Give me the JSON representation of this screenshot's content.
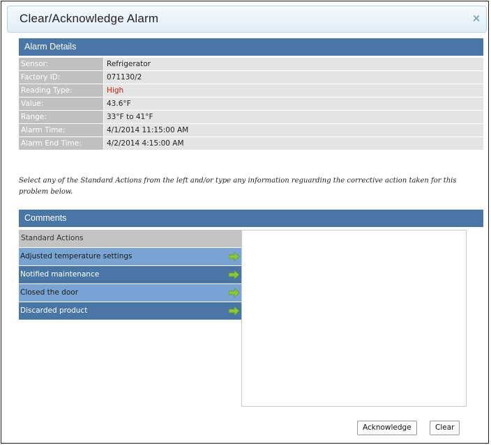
{
  "dialog": {
    "title": "Clear/Acknowledge Alarm",
    "close_glyph": "×"
  },
  "alarm_details": {
    "header": "Alarm Details",
    "rows": [
      {
        "label": "Sensor:",
        "value": "Refrigerator"
      },
      {
        "label": "Factory ID:",
        "value": "071130/2"
      },
      {
        "label": "Reading Type:",
        "value": "High",
        "value_color": "#d21414"
      },
      {
        "label": "Value:",
        "value": "43.6°F"
      },
      {
        "label": "Range:",
        "value": "33°F to 41°F"
      },
      {
        "label": "Alarm Time:",
        "value": "4/1/2014 11:15:00 AM"
      },
      {
        "label": "Alarm End Time:",
        "value": "4/2/2014 4:15:00 AM"
      }
    ]
  },
  "instructions": "Select any of the Standard Actions from the left and/or type any information reguarding the corrective action taken for this problem below.",
  "comments": {
    "header": "Comments",
    "standard_actions_label": "Standard Actions",
    "actions": [
      {
        "label": "Adjusted temperature settings",
        "icon": "green-arrow-icon"
      },
      {
        "label": "Notified maintenance",
        "icon": "green-arrow-icon"
      },
      {
        "label": "Closed the door",
        "icon": "green-arrow-icon"
      },
      {
        "label": "Discarded product",
        "icon": "green-arrow-icon"
      }
    ],
    "comment_text": ""
  },
  "buttons": {
    "acknowledge": "Acknowledge",
    "clear": "Clear"
  },
  "colors": {
    "header_blue": "#4a76a6",
    "row_light_blue": "#79a3d2",
    "alert_red": "#d21414",
    "arrow_green": "#8cc63f"
  }
}
